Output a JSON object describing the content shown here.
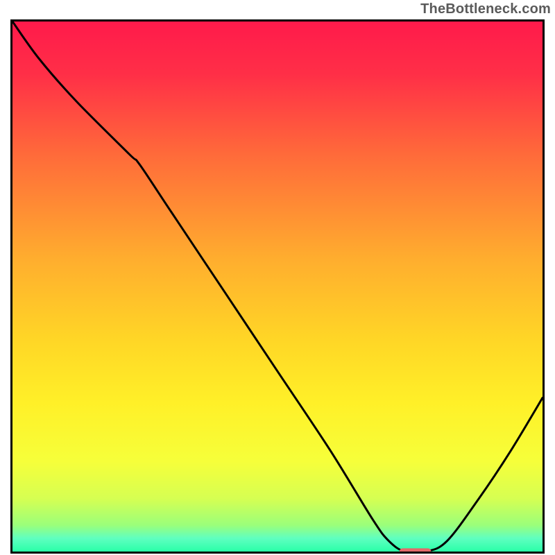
{
  "watermark": "TheBottleneck.com",
  "chart_data": {
    "type": "line",
    "title": "",
    "xlabel": "",
    "ylabel": "",
    "xlim": [
      0,
      100
    ],
    "ylim": [
      0,
      100
    ],
    "grid": false,
    "legend": false,
    "annotations": [],
    "series": [
      {
        "name": "bottleneck-curve",
        "color": "#000000",
        "x": [
          0,
          5,
          12,
          22,
          24,
          30,
          40,
          50,
          60,
          68,
          71,
          74,
          78,
          82,
          88,
          94,
          100
        ],
        "y": [
          100,
          93,
          85,
          75,
          73,
          64,
          49,
          34,
          19,
          6,
          2,
          0,
          0,
          2,
          10,
          19,
          29
        ]
      }
    ],
    "marker": {
      "name": "optimal-point",
      "color": "#e26a6a",
      "x": 76,
      "y": 0,
      "width_pct": 6,
      "height_pct": 1.2
    },
    "gradient_stops": [
      {
        "offset": 0.0,
        "color": "#ff1a4b"
      },
      {
        "offset": 0.1,
        "color": "#ff2f47"
      },
      {
        "offset": 0.25,
        "color": "#ff6a3a"
      },
      {
        "offset": 0.45,
        "color": "#ffae2e"
      },
      {
        "offset": 0.6,
        "color": "#ffd626"
      },
      {
        "offset": 0.72,
        "color": "#fff028"
      },
      {
        "offset": 0.83,
        "color": "#f6ff3a"
      },
      {
        "offset": 0.9,
        "color": "#d6ff52"
      },
      {
        "offset": 0.95,
        "color": "#9bff7a"
      },
      {
        "offset": 0.975,
        "color": "#5fffc0"
      },
      {
        "offset": 1.0,
        "color": "#2affa8"
      }
    ]
  }
}
